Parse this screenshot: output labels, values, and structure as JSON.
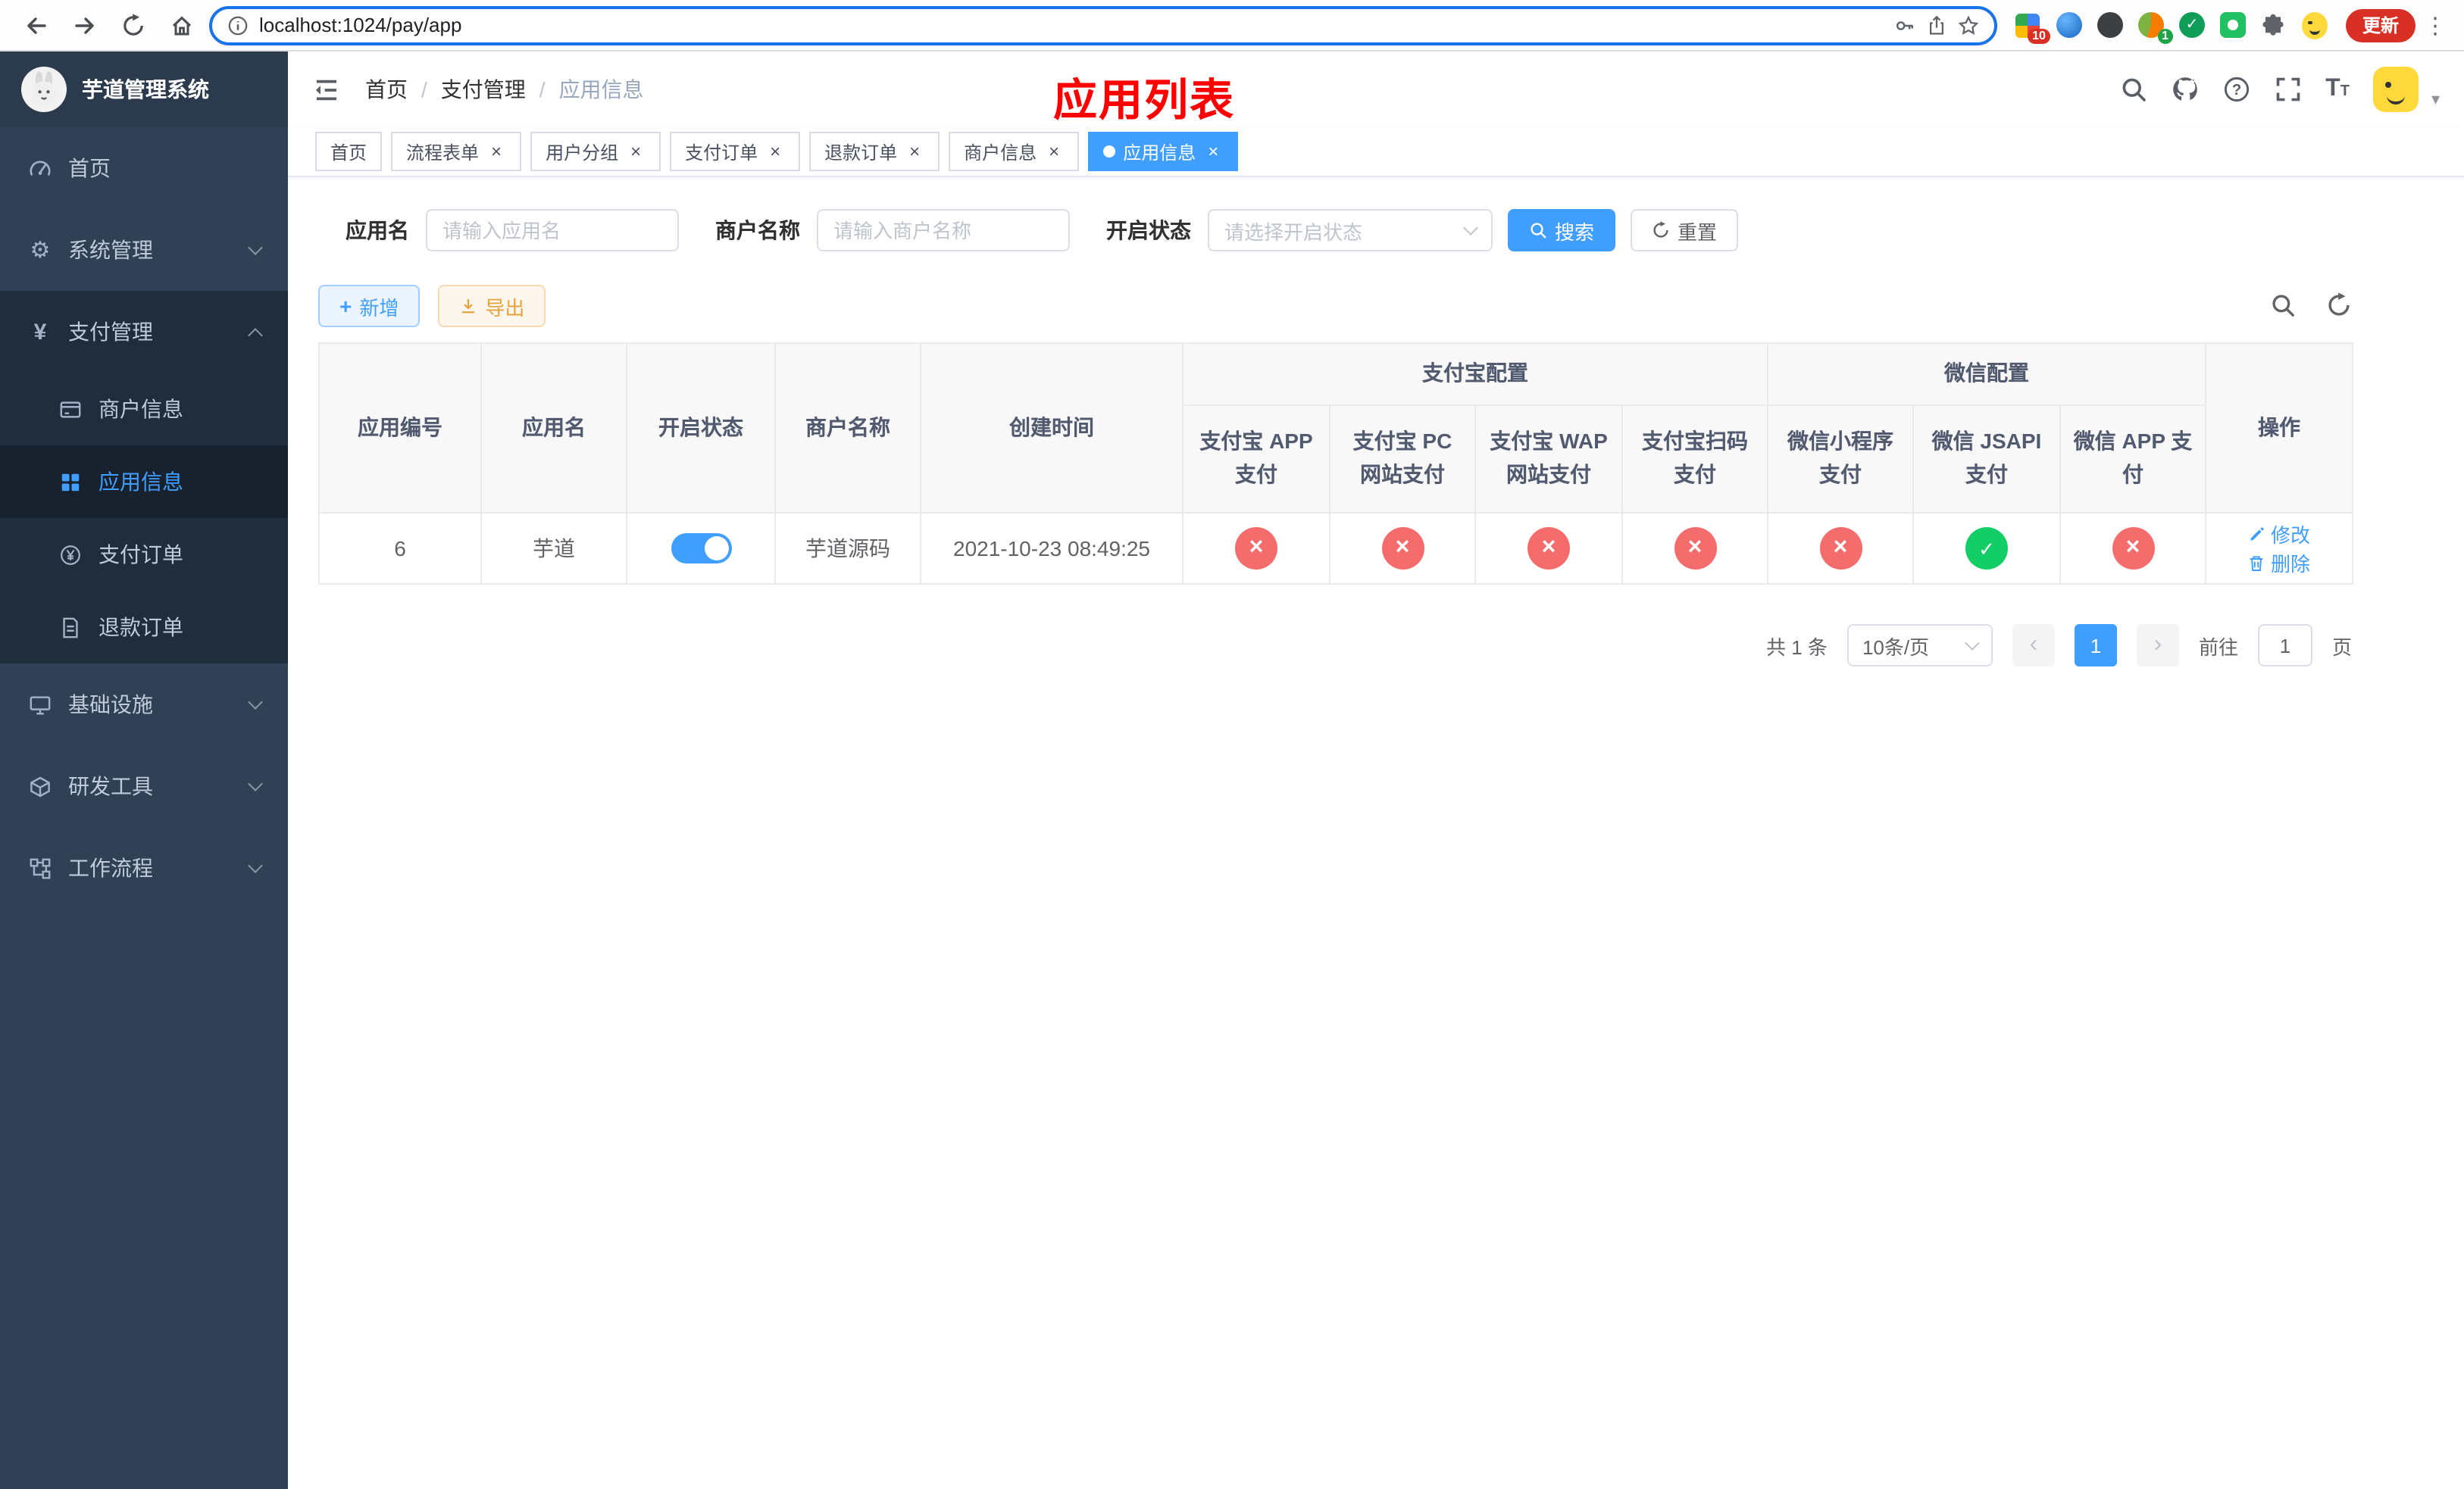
{
  "browser": {
    "url": "localhost:1024/pay/app",
    "update_label": "更新",
    "extension_badge": "10",
    "profile_badge": "1"
  },
  "sidebar": {
    "app_title": "芋道管理系统",
    "items": [
      {
        "label": "首页"
      },
      {
        "label": "系统管理"
      },
      {
        "label": "支付管理",
        "children": [
          {
            "label": "商户信息"
          },
          {
            "label": "应用信息"
          },
          {
            "label": "支付订单"
          },
          {
            "label": "退款订单"
          }
        ]
      },
      {
        "label": "基础设施"
      },
      {
        "label": "研发工具"
      },
      {
        "label": "工作流程"
      }
    ]
  },
  "navbar": {
    "breadcrumb": [
      {
        "label": "首页"
      },
      {
        "label": "支付管理"
      },
      {
        "label": "应用信息"
      }
    ],
    "page_title": "应用列表"
  },
  "tabs": [
    {
      "label": "首页"
    },
    {
      "label": "流程表单"
    },
    {
      "label": "用户分组"
    },
    {
      "label": "支付订单"
    },
    {
      "label": "退款订单"
    },
    {
      "label": "商户信息"
    },
    {
      "label": "应用信息"
    }
  ],
  "filters": {
    "app_name_label": "应用名",
    "app_name_placeholder": "请输入应用名",
    "merchant_label": "商户名称",
    "merchant_placeholder": "请输入商户名称",
    "status_label": "开启状态",
    "status_placeholder": "请选择开启状态",
    "search_label": "搜索",
    "reset_label": "重置"
  },
  "toolbar": {
    "add_label": "新增",
    "export_label": "导出"
  },
  "table": {
    "simple_columns": [
      "应用编号",
      "应用名",
      "开启状态",
      "商户名称",
      "创建时间"
    ],
    "group_columns": [
      {
        "label": "支付宝配置",
        "children": [
          "支付宝 APP 支付",
          "支付宝 PC 网站支付",
          "支付宝 WAP 网站支付",
          "支付宝扫码支付"
        ]
      },
      {
        "label": "微信配置",
        "children": [
          "微信小程序支付",
          "微信 JSAPI 支付",
          "微信 APP 支付"
        ]
      }
    ],
    "action_column": "操作",
    "row": {
      "id": "6",
      "name": "芋道",
      "enabled": true,
      "merchant": "芋道源码",
      "created_at": "2021-10-23 08:49:25",
      "configs": [
        false,
        false,
        false,
        false,
        false,
        true,
        false
      ],
      "edit_label": "修改",
      "delete_label": "删除"
    }
  },
  "pagination": {
    "total_text": "共 1 条",
    "page_size": "10条/页",
    "current_page": "1",
    "goto_label": "前往",
    "goto_value": "1",
    "page_unit": "页"
  }
}
